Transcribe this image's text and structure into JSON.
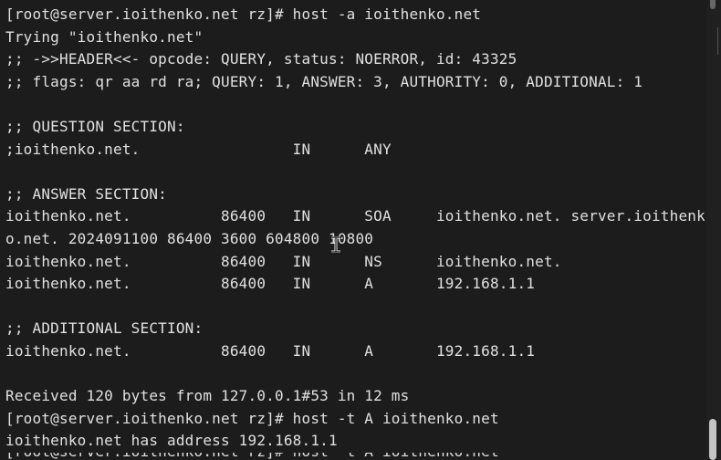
{
  "terminal": {
    "lines": [
      "[root@server.ioithenko.net rz]# host -a ioithenko.net",
      "Trying \"ioithenko.net\"",
      ";; ->>HEADER<<- opcode: QUERY, status: NOERROR, id: 43325",
      ";; flags: qr aa rd ra; QUERY: 1, ANSWER: 3, AUTHORITY: 0, ADDITIONAL: 1",
      "",
      ";; QUESTION SECTION:",
      ";ioithenko.net.                 IN      ANY",
      "",
      ";; ANSWER SECTION:",
      "ioithenko.net.          86400   IN      SOA     ioithenko.net. server.ioithenk",
      "o.net. 2024091100 86400 3600 604800 10800",
      "ioithenko.net.          86400   IN      NS      ioithenko.net.",
      "ioithenko.net.          86400   IN      A       192.168.1.1",
      "",
      ";; ADDITIONAL SECTION:",
      "ioithenko.net.          86400   IN      A       192.168.1.1",
      "",
      "Received 120 bytes from 127.0.0.1#53 in 12 ms",
      "[root@server.ioithenko.net rz]# host -t A ioithenko.net",
      "ioithenko.net has address 192.168.1.1",
      "[root@server.ioithenko.net rz]# host -t A ioithenko.net"
    ]
  },
  "scrollbar": {
    "position": "bottom"
  },
  "mouse_cursor": {
    "icon": "text-cursor-icon"
  }
}
